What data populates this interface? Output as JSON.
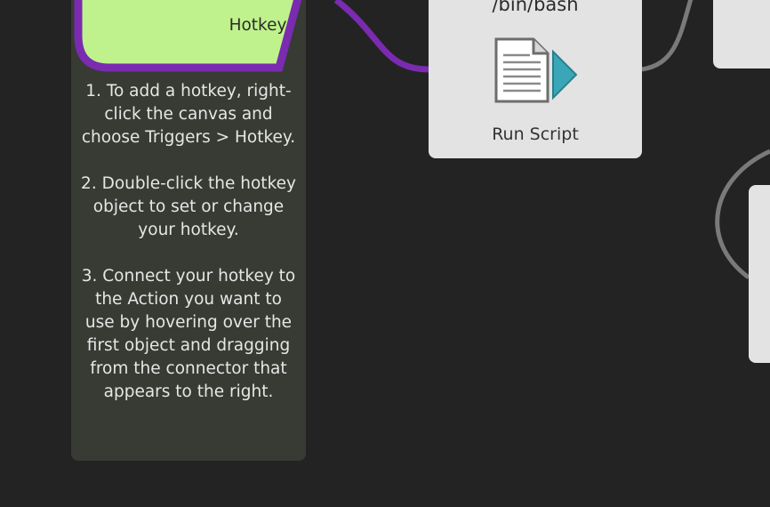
{
  "canvas": {
    "background": "#232323",
    "accent_wire": "#7a2bb0",
    "wire_gray": "#7a7a7a"
  },
  "hotkey_node": {
    "label": "Hotkey",
    "fill": "#bff28c",
    "border": "#7a2bb0"
  },
  "note": {
    "text": "1. To add a hotkey, right-click the canvas and choose Triggers > Hotkey.\n\n2. Double-click the hotkey object to set or change your hotkey.\n\n3. Connect your hotkey to the Action you want to use by hovering over the first object and dragging from the connector that appears to the right."
  },
  "action_node": {
    "subtitle": "/bin/bash",
    "label": "Run Script",
    "icon": "script-document-icon"
  }
}
